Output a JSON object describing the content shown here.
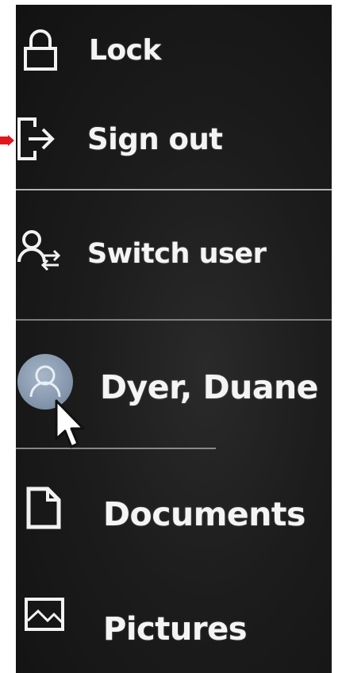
{
  "menu": {
    "lock": {
      "label": "Lock",
      "icon": "lock-icon"
    },
    "sign_out": {
      "label": "Sign out",
      "icon": "sign-out-icon"
    },
    "switch_user": {
      "label": "Switch user",
      "icon": "switch-user-icon"
    },
    "user": {
      "label": "Dyer, Duane",
      "icon": "user-avatar-icon"
    },
    "documents": {
      "label": "Documents",
      "icon": "document-icon"
    },
    "pictures": {
      "label": "Pictures",
      "icon": "picture-icon"
    }
  },
  "annotation": {
    "marker": "red-arrow-icon",
    "color": "#e0191d"
  },
  "colors": {
    "background": "#1c1c1c",
    "text": "#f4f4f4",
    "divider": "#cfcfcf",
    "avatar": "#8597ad"
  }
}
